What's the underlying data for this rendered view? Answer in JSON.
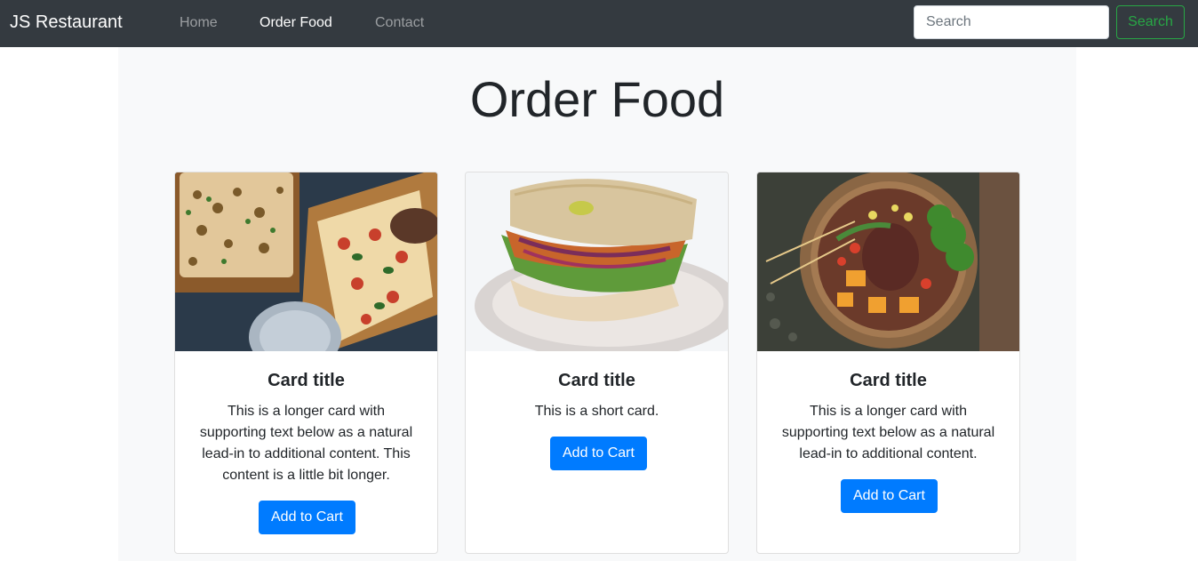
{
  "navbar": {
    "brand": "JS Restaurant",
    "links": [
      {
        "label": "Home",
        "active": false
      },
      {
        "label": "Order Food",
        "active": true
      },
      {
        "label": "Contact",
        "active": false
      }
    ],
    "search": {
      "placeholder": "Search",
      "button_label": "Search"
    }
  },
  "page": {
    "title": "Order Food"
  },
  "cards": [
    {
      "image": "pizza-flatbread-photo",
      "title": "Card title",
      "text": "This is a longer card with supporting text below as a natural lead-in to additional content. This content is a little bit longer.",
      "button_label": "Add to Cart"
    },
    {
      "image": "sandwich-photo",
      "title": "Card title",
      "text": "This is a short card.",
      "button_label": "Add to Cart"
    },
    {
      "image": "grain-bowl-photo",
      "title": "Card title",
      "text": "This is a longer card with supporting text below as a natural lead-in to additional content.",
      "button_label": "Add to Cart"
    }
  ],
  "colors": {
    "navbar_bg": "#343a40",
    "primary": "#007bff",
    "success": "#28a745",
    "content_bg": "#f8f9fa"
  }
}
